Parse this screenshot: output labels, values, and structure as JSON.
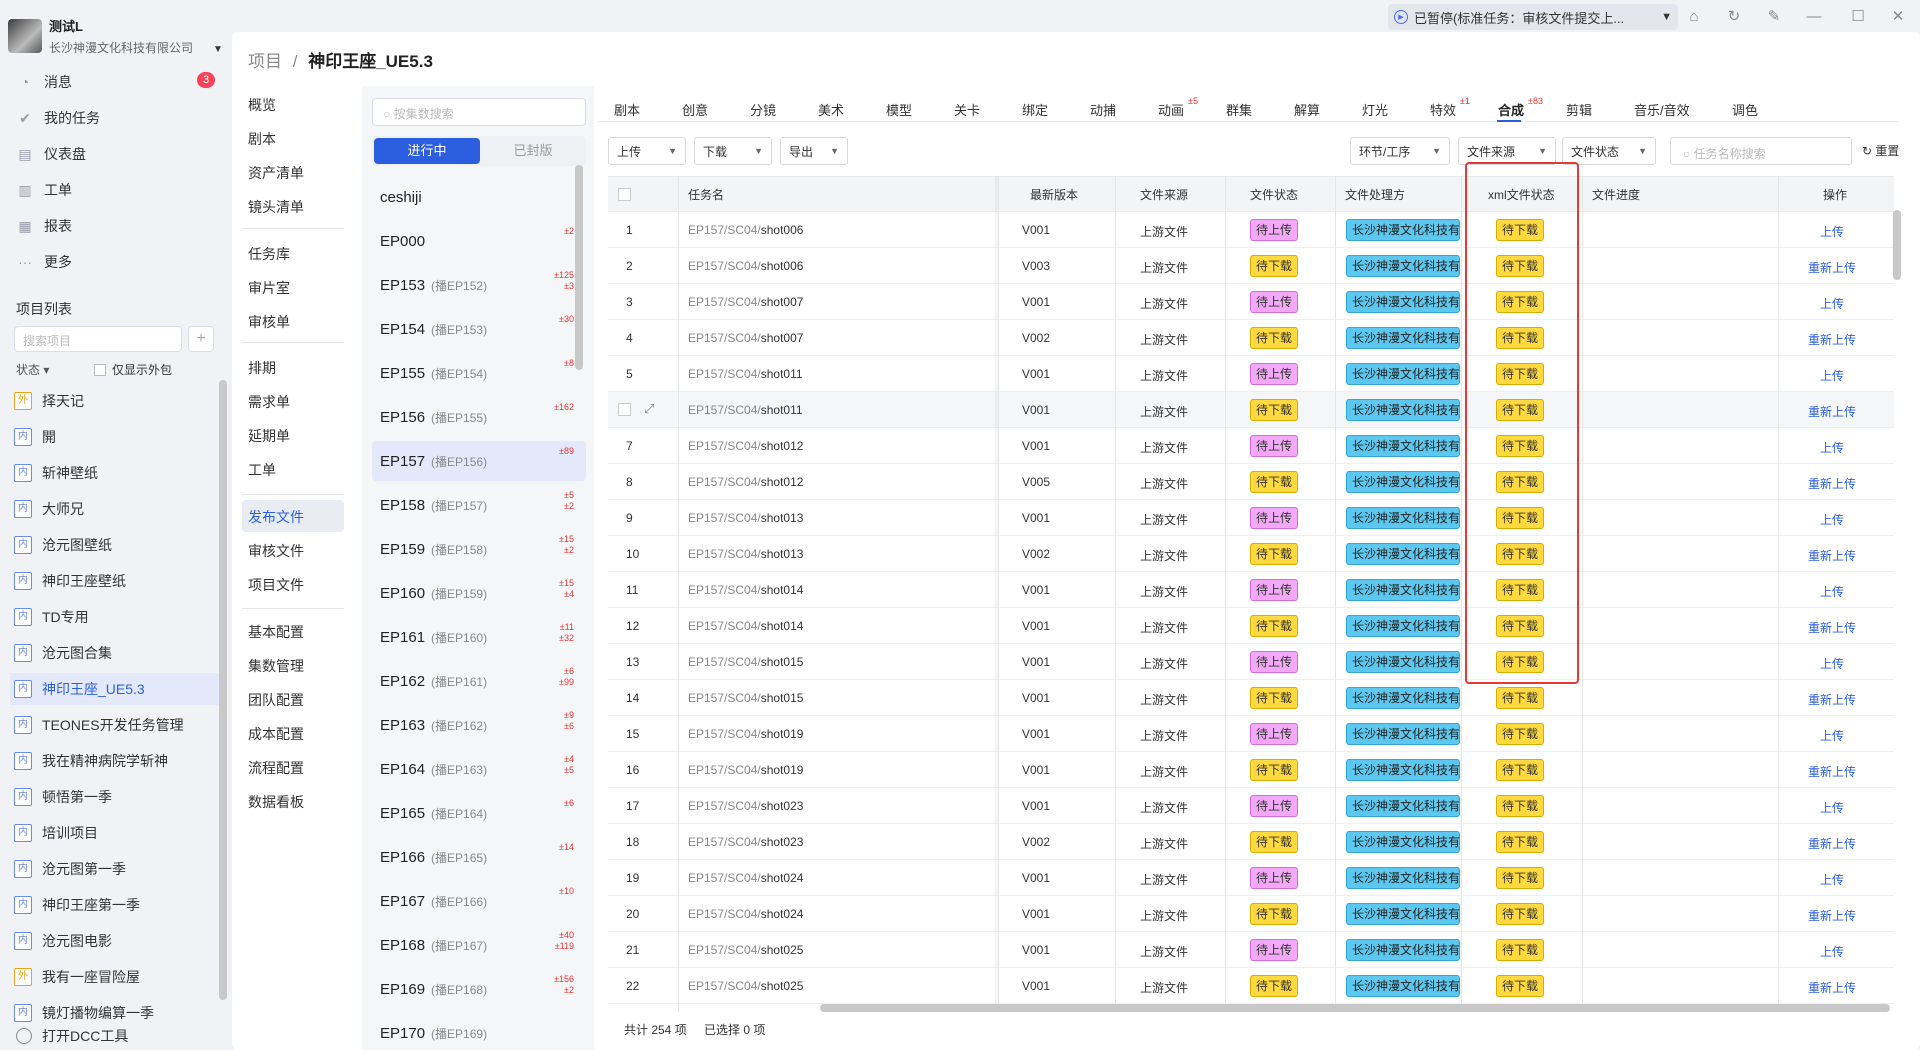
{
  "user": {
    "name": "测试L",
    "company": "长沙神漫文化科技有限公司"
  },
  "titlebar": {
    "task_status": "已暂停(标准任务：审核文件提交上..."
  },
  "leftnav": {
    "items": [
      {
        "label": "消息",
        "icon": "bell-icon",
        "glyph": "◔"
      },
      {
        "label": "我的任务",
        "icon": "check-icon",
        "glyph": "✔"
      },
      {
        "label": "仪表盘",
        "icon": "dashboard-icon",
        "glyph": "▤"
      },
      {
        "label": "工单",
        "icon": "ticket-icon",
        "glyph": "▥"
      },
      {
        "label": "报表",
        "icon": "report-icon",
        "glyph": "▦"
      },
      {
        "label": "更多",
        "icon": "more-icon",
        "glyph": "···"
      }
    ],
    "message_badge": "3",
    "project_list_title": "项目列表",
    "search_placeholder": "搜索项目",
    "add_label": "+",
    "status_label": "状态",
    "outsource_label": "仅显示外包",
    "projects": [
      {
        "tag": "外",
        "name": "择天记",
        "out": true
      },
      {
        "tag": "内",
        "name": "開"
      },
      {
        "tag": "内",
        "name": "斩神壁纸"
      },
      {
        "tag": "内",
        "name": "大师兄"
      },
      {
        "tag": "内",
        "name": "沧元图壁纸"
      },
      {
        "tag": "内",
        "name": "神印王座壁纸"
      },
      {
        "tag": "内",
        "name": "TD专用"
      },
      {
        "tag": "内",
        "name": "沧元图合集"
      },
      {
        "tag": "内",
        "name": "神印王座_UE5.3",
        "active": true
      },
      {
        "tag": "内",
        "name": "TEONES开发任务管理"
      },
      {
        "tag": "内",
        "name": "我在精神病院学斩神"
      },
      {
        "tag": "内",
        "name": "顿悟第一季"
      },
      {
        "tag": "内",
        "name": "培训项目"
      },
      {
        "tag": "内",
        "name": "沧元图第一季"
      },
      {
        "tag": "内",
        "name": "神印王座第一季"
      },
      {
        "tag": "内",
        "name": "沧元图电影"
      },
      {
        "tag": "外",
        "name": "我有一座冒险屋",
        "out": true
      },
      {
        "tag": "内",
        "name": "镜灯播物编算一季"
      }
    ],
    "dcc_label": "打开DCC工具"
  },
  "breadcrumb": {
    "root": "项目",
    "sep": "/",
    "current": "神印王座_UE5.3"
  },
  "subnav": [
    "概览",
    "剧本",
    "资产清单",
    "镜头清单",
    "任务库",
    "审片室",
    "审核单",
    "排期",
    "需求单",
    "延期单",
    "工单",
    "发布文件",
    "审核文件",
    "项目文件",
    "基本配置",
    "集数管理",
    "团队配置",
    "成本配置",
    "流程配置",
    "数据看板"
  ],
  "episodes": {
    "search_placeholder": "按集数搜索",
    "tab_active": "进行中",
    "tab_inactive": "已封版",
    "items": [
      {
        "name": "ceshiji",
        "sub": "",
        "c1": "",
        "c2": ""
      },
      {
        "name": "EP000",
        "sub": "",
        "c1": "±2",
        "c2": ""
      },
      {
        "name": "EP153",
        "sub": "(播EP152)",
        "c1": "±125",
        "c2": "±3"
      },
      {
        "name": "EP154",
        "sub": "(播EP153)",
        "c1": "±30",
        "c2": ""
      },
      {
        "name": "EP155",
        "sub": "(播EP154)",
        "c1": "±8",
        "c2": ""
      },
      {
        "name": "EP156",
        "sub": "(播EP155)",
        "c1": "±162",
        "c2": ""
      },
      {
        "name": "EP157",
        "sub": "(播EP156)",
        "c1": "±89",
        "c2": "",
        "active": true
      },
      {
        "name": "EP158",
        "sub": "(播EP157)",
        "c1": "±5",
        "c2": "±2"
      },
      {
        "name": "EP159",
        "sub": "(播EP158)",
        "c1": "±15",
        "c2": "±2"
      },
      {
        "name": "EP160",
        "sub": "(播EP159)",
        "c1": "±15",
        "c2": "±4"
      },
      {
        "name": "EP161",
        "sub": "(播EP160)",
        "c1": "±11",
        "c2": "±32"
      },
      {
        "name": "EP162",
        "sub": "(播EP161)",
        "c1": "±6",
        "c2": "±99"
      },
      {
        "name": "EP163",
        "sub": "(播EP162)",
        "c1": "±9",
        "c2": "±6"
      },
      {
        "name": "EP164",
        "sub": "(播EP163)",
        "c1": "±4",
        "c2": "±5"
      },
      {
        "name": "EP165",
        "sub": "(播EP164)",
        "c1": "±6",
        "c2": ""
      },
      {
        "name": "EP166",
        "sub": "(播EP165)",
        "c1": "±14",
        "c2": ""
      },
      {
        "name": "EP167",
        "sub": "(播EP166)",
        "c1": "±10",
        "c2": ""
      },
      {
        "name": "EP168",
        "sub": "(播EP167)",
        "c1": "±40",
        "c2": "±119"
      },
      {
        "name": "EP169",
        "sub": "(播EP168)",
        "c1": "±156",
        "c2": "±2"
      },
      {
        "name": "EP170",
        "sub": "(播EP169)",
        "c1": "",
        "c2": ""
      }
    ]
  },
  "tabs": [
    {
      "label": "剧本"
    },
    {
      "label": "创意"
    },
    {
      "label": "分镜"
    },
    {
      "label": "美术"
    },
    {
      "label": "模型"
    },
    {
      "label": "关卡"
    },
    {
      "label": "绑定"
    },
    {
      "label": "动捕"
    },
    {
      "label": "动画",
      "sup": "±5"
    },
    {
      "label": "群集"
    },
    {
      "label": "解算"
    },
    {
      "label": "灯光"
    },
    {
      "label": "特效",
      "sup": "±1"
    },
    {
      "label": "合成",
      "sup": "±83",
      "active": true
    },
    {
      "label": "剪辑"
    },
    {
      "label": "音乐/音效"
    },
    {
      "label": "调色"
    }
  ],
  "toolbar": {
    "upload": "上传",
    "download": "下载",
    "export": "导出",
    "stage_filter": "环节/工序",
    "source_filter": "文件来源",
    "status_filter": "文件状态",
    "search_placeholder": "任务名称搜索",
    "reset": "重置"
  },
  "table": {
    "headers": {
      "name": "任务名",
      "version": "最新版本",
      "source": "文件来源",
      "status": "文件状态",
      "processor": "文件处理方",
      "xml": "xml文件状态",
      "progress": "文件进度",
      "action": "操作"
    },
    "rows": [
      {
        "no": "1",
        "prefix": "EP157/SC04/",
        "shot": "shot006",
        "ver": "V001",
        "src": "上游文件",
        "st": "待上传",
        "proc": "长沙神漫文化科技有限公司",
        "xml": "待下载",
        "op": "上传"
      },
      {
        "no": "2",
        "prefix": "EP157/SC04/",
        "shot": "shot006",
        "ver": "V003",
        "src": "上游文件",
        "st": "待下载",
        "proc": "长沙神漫文化科技有限公司",
        "xml": "待下载",
        "op": "重新上传"
      },
      {
        "no": "3",
        "prefix": "EP157/SC04/",
        "shot": "shot007",
        "ver": "V001",
        "src": "上游文件",
        "st": "待上传",
        "proc": "长沙神漫文化科技有限公司",
        "xml": "待下载",
        "op": "上传"
      },
      {
        "no": "4",
        "prefix": "EP157/SC04/",
        "shot": "shot007",
        "ver": "V002",
        "src": "上游文件",
        "st": "待下载",
        "proc": "长沙神漫文化科技有限公司",
        "xml": "待下载",
        "op": "重新上传"
      },
      {
        "no": "5",
        "prefix": "EP157/SC04/",
        "shot": "shot011",
        "ver": "V001",
        "src": "上游文件",
        "st": "待上传",
        "proc": "长沙神漫文化科技有限公司",
        "xml": "待下载",
        "op": "上传"
      },
      {
        "no": "",
        "prefix": "EP157/SC04/",
        "shot": "shot011",
        "ver": "V001",
        "src": "上游文件",
        "st": "待下载",
        "proc": "长沙神漫文化科技有限公司",
        "xml": "待下载",
        "op": "重新上传",
        "hover": true
      },
      {
        "no": "7",
        "prefix": "EP157/SC04/",
        "shot": "shot012",
        "ver": "V001",
        "src": "上游文件",
        "st": "待上传",
        "proc": "长沙神漫文化科技有限公司",
        "xml": "待下载",
        "op": "上传"
      },
      {
        "no": "8",
        "prefix": "EP157/SC04/",
        "shot": "shot012",
        "ver": "V005",
        "src": "上游文件",
        "st": "待下载",
        "proc": "长沙神漫文化科技有限公司",
        "xml": "待下载",
        "op": "重新上传"
      },
      {
        "no": "9",
        "prefix": "EP157/SC04/",
        "shot": "shot013",
        "ver": "V001",
        "src": "上游文件",
        "st": "待上传",
        "proc": "长沙神漫文化科技有限公司",
        "xml": "待下载",
        "op": "上传"
      },
      {
        "no": "10",
        "prefix": "EP157/SC04/",
        "shot": "shot013",
        "ver": "V002",
        "src": "上游文件",
        "st": "待下载",
        "proc": "长沙神漫文化科技有限公司",
        "xml": "待下载",
        "op": "重新上传"
      },
      {
        "no": "11",
        "prefix": "EP157/SC04/",
        "shot": "shot014",
        "ver": "V001",
        "src": "上游文件",
        "st": "待上传",
        "proc": "长沙神漫文化科技有限公司",
        "xml": "待下载",
        "op": "上传"
      },
      {
        "no": "12",
        "prefix": "EP157/SC04/",
        "shot": "shot014",
        "ver": "V001",
        "src": "上游文件",
        "st": "待下载",
        "proc": "长沙神漫文化科技有限公司",
        "xml": "待下载",
        "op": "重新上传"
      },
      {
        "no": "13",
        "prefix": "EP157/SC04/",
        "shot": "shot015",
        "ver": "V001",
        "src": "上游文件",
        "st": "待上传",
        "proc": "长沙神漫文化科技有限公司",
        "xml": "待下载",
        "op": "上传"
      },
      {
        "no": "14",
        "prefix": "EP157/SC04/",
        "shot": "shot015",
        "ver": "V001",
        "src": "上游文件",
        "st": "待下载",
        "proc": "长沙神漫文化科技有限公司",
        "xml": "待下载",
        "op": "重新上传"
      },
      {
        "no": "15",
        "prefix": "EP157/SC04/",
        "shot": "shot019",
        "ver": "V001",
        "src": "上游文件",
        "st": "待上传",
        "proc": "长沙神漫文化科技有限公司",
        "xml": "待下载",
        "op": "上传"
      },
      {
        "no": "16",
        "prefix": "EP157/SC04/",
        "shot": "shot019",
        "ver": "V001",
        "src": "上游文件",
        "st": "待下载",
        "proc": "长沙神漫文化科技有限公司",
        "xml": "待下载",
        "op": "重新上传"
      },
      {
        "no": "17",
        "prefix": "EP157/SC04/",
        "shot": "shot023",
        "ver": "V001",
        "src": "上游文件",
        "st": "待上传",
        "proc": "长沙神漫文化科技有限公司",
        "xml": "待下载",
        "op": "上传"
      },
      {
        "no": "18",
        "prefix": "EP157/SC04/",
        "shot": "shot023",
        "ver": "V002",
        "src": "上游文件",
        "st": "待下载",
        "proc": "长沙神漫文化科技有限公司",
        "xml": "待下载",
        "op": "重新上传"
      },
      {
        "no": "19",
        "prefix": "EP157/SC04/",
        "shot": "shot024",
        "ver": "V001",
        "src": "上游文件",
        "st": "待上传",
        "proc": "长沙神漫文化科技有限公司",
        "xml": "待下载",
        "op": "上传"
      },
      {
        "no": "20",
        "prefix": "EP157/SC04/",
        "shot": "shot024",
        "ver": "V001",
        "src": "上游文件",
        "st": "待下载",
        "proc": "长沙神漫文化科技有限公司",
        "xml": "待下载",
        "op": "重新上传"
      },
      {
        "no": "21",
        "prefix": "EP157/SC04/",
        "shot": "shot025",
        "ver": "V001",
        "src": "上游文件",
        "st": "待上传",
        "proc": "长沙神漫文化科技有限公司",
        "xml": "待下载",
        "op": "上传"
      },
      {
        "no": "22",
        "prefix": "EP157/SC04/",
        "shot": "shot025",
        "ver": "V001",
        "src": "上游文件",
        "st": "待下载",
        "proc": "长沙神漫文化科技有限公司",
        "xml": "待下载",
        "op": "重新上传"
      }
    ],
    "total": "共计 254 项",
    "selected": "已选择 0 项"
  },
  "colors": {
    "accent": "#2c5fe0",
    "upload_tag": "#f3a9f8",
    "download_tag": "#ffd93d",
    "processor_tag": "#5cc8f0",
    "highlight_box": "#e53935"
  }
}
